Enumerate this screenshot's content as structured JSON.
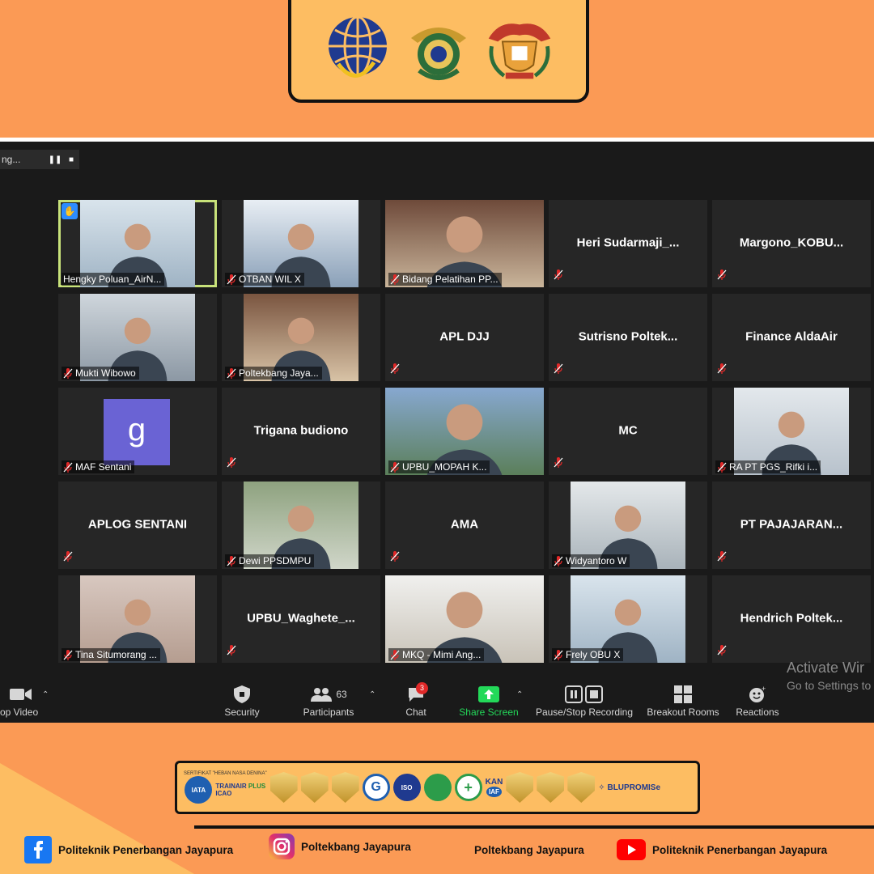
{
  "recording": {
    "label": "ng..."
  },
  "participants": [
    {
      "name": "Hengky Poluan_AirN...",
      "video": true,
      "active": true,
      "hand": true
    },
    {
      "name": "OTBAN WIL X",
      "video": true
    },
    {
      "name": "Bidang Pelatihan PP...",
      "video": true
    },
    {
      "name": "Heri  Sudarmaji_...",
      "video": false
    },
    {
      "name": "Margono_KOBU...",
      "video": false
    },
    {
      "name": "Mukti Wibowo",
      "video": true
    },
    {
      "name": "Poltekbang Jaya...",
      "video": true
    },
    {
      "name": "APL DJJ",
      "video": false
    },
    {
      "name": "Sutrisno   Poltek...",
      "video": false
    },
    {
      "name": "Finance AldaAir",
      "video": false
    },
    {
      "name": "MAF Sentani",
      "video": false,
      "avatar_letter": "g"
    },
    {
      "name": "Trigana budiono",
      "video": false
    },
    {
      "name": "UPBU_MOPAH K...",
      "video": true
    },
    {
      "name": "MC",
      "video": false
    },
    {
      "name": "RA PT PGS_Rifki i...",
      "video": true
    },
    {
      "name": "APLOG SENTANI",
      "video": false
    },
    {
      "name": "Dewi PPSDMPU",
      "video": true
    },
    {
      "name": "AMA",
      "video": false
    },
    {
      "name": "Widyantoro W",
      "video": true
    },
    {
      "name": "PT PAJAJARAN...",
      "video": false
    },
    {
      "name": "Tina Situmorang ...",
      "video": true
    },
    {
      "name": "UPBU_Waghete_...",
      "video": false
    },
    {
      "name": "MKQ - Mimi Ang...",
      "video": true
    },
    {
      "name": "Frely OBU X",
      "video": true
    },
    {
      "name": "Hendrich  Poltek...",
      "video": false
    }
  ],
  "toolbar": {
    "stop_video": "op Video",
    "security": "Security",
    "participants_label": "Participants",
    "participants_count": "63",
    "chat": "Chat",
    "chat_badge": "3",
    "share_screen": "Share Screen",
    "recording": "Pause/Stop Recording",
    "breakout": "Breakout Rooms",
    "reactions": "Reactions"
  },
  "watermark": {
    "title": "Activate Wir",
    "subtitle": "Go to Settings to"
  },
  "partners": {
    "caption": "SERTIFIKAT \"HEBAN NASA DENINA\"",
    "trainair": "TRAINAIR",
    "trainair_plus": "PLUS",
    "icao": "ICAO",
    "iata": "IATA",
    "iso": "ISO",
    "kan": "KAN",
    "iaf": "IAF",
    "blu": "BLUPROMISe"
  },
  "footer": {
    "facebook": "Politeknik Penerbangan Jayapura",
    "instagram": "Poltekbang Jayapura",
    "tiktok": "Poltekbang Jayapura",
    "youtube": "Politeknik Penerbangan Jayapura"
  },
  "colors": {
    "accent_orange": "#fb9a55",
    "panel_yellow": "#fdbd62",
    "zoom_bg": "#1a1a1a",
    "share_green": "#23d959",
    "active_border": "#c8e27a"
  }
}
